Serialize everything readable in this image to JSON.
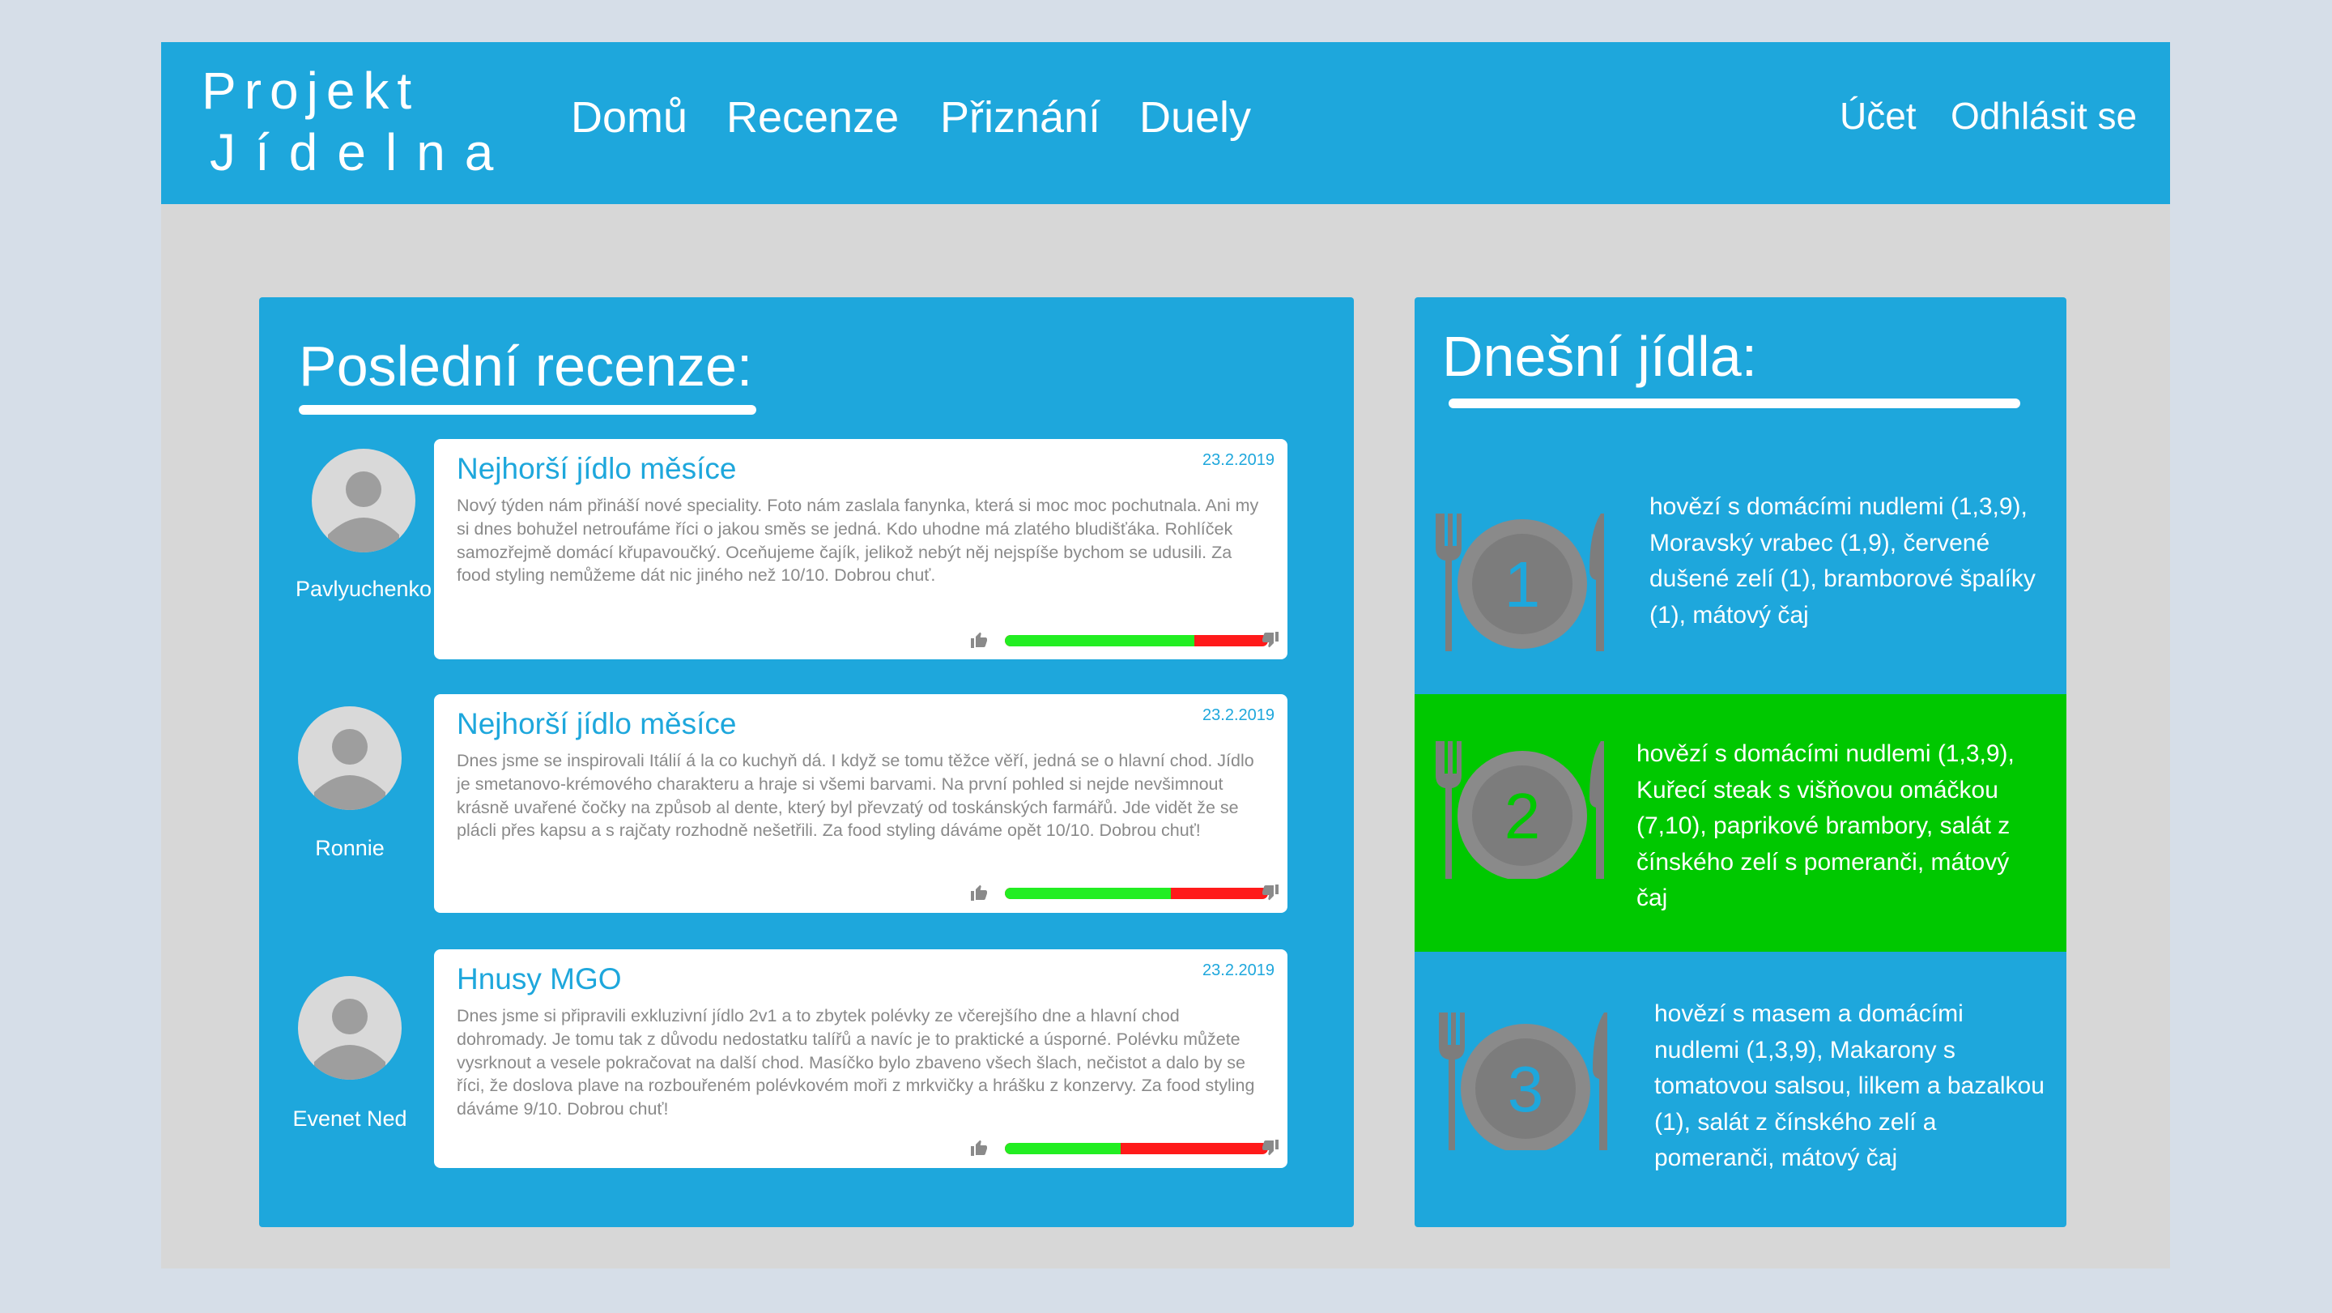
{
  "header": {
    "logo_line1": "Projekt",
    "logo_line2": "Jídelna",
    "nav": [
      "Domů",
      "Recenze",
      "Přiznání",
      "Duely"
    ],
    "account": "Účet",
    "logout": "Odhlásit se"
  },
  "colors": {
    "primary": "#1ea7dc",
    "active_meal": "#00c800",
    "like": "#22ee22",
    "dislike": "#ff1a1a"
  },
  "reviews_panel": {
    "title": "Poslední recenze:",
    "reviews": [
      {
        "author": "Pavlyuchenko",
        "title": "Nejhorší jídlo měsíce",
        "date": "23.2.2019",
        "text": "Nový týden nám přináší nové speciality. Foto nám zaslala fanynka, která si moc moc pochutnala. Ani my si dnes bohužel netroufáme říci o jakou směs se jedná. Kdo uhodne má zlatého bludišťáka. Rohlíček samozřejmě domácí křupavoučký. Oceňujeme čajík, jelikož nebýt něj nejspíše bychom se udusili. Za food styling nemůžeme dát nic jiného než 10/10. Dobrou chuť.",
        "like_ratio": 0.72
      },
      {
        "author": "Ronnie",
        "title": "Nejhorší jídlo měsíce",
        "date": "23.2.2019",
        "text": "Dnes jsme se inspirovali Itálií á la co kuchyň dá. I když se tomu těžce věří, jedná se o hlavní chod. Jídlo je smetanovo-krémového charakteru a hraje si všemi barvami. Na první pohled si nejde nevšimnout krásně uvařené čočky na způsob al dente, který byl převzatý od toskánských farmářů. Jde vidět že se plácli přes kapsu a s rajčaty rozhodně nešetřili. Za food styling dáváme opět 10/10. Dobrou chuť!",
        "like_ratio": 0.63
      },
      {
        "author": "Evenet Ned",
        "title": "Hnusy MGO",
        "date": "23.2.2019",
        "text": "Dnes jsme si připravili exkluzivní jídlo 2v1 a to zbytek polévky ze včerejšího dne a hlavní chod dohromady. Je tomu tak z důvodu nedostatku talířů a navíc je to praktické a úsporné. Polévku můžete vysrknout a vesele pokračovat na další chod. Masíčko bylo zbaveno všech šlach, nečistot a dalo by se říci, že doslova plave na rozbouřeném polévkovém moři z mrkvičky a hrášku z konzervy. Za food styling dáváme 9/10. Dobrou chuť!",
        "like_ratio": 0.44
      }
    ]
  },
  "meals_panel": {
    "title": "Dnešní jídla:",
    "meals": [
      {
        "number": "1",
        "text": "hovězí s domácími nudlemi (1,3,9), Moravský vrabec (1,9), červené dušené zelí (1), bramborové špalíky (1), mátový čaj",
        "active": false
      },
      {
        "number": "2",
        "text": "hovězí s domácími nudlemi (1,3,9), Kuřecí steak s višňovou omáčkou (7,10), paprikové brambory, salát z čínského zelí s pomeranči, mátový čaj",
        "active": true
      },
      {
        "number": "3",
        "text": "hovězí s masem a domácími nudlemi (1,3,9), Makarony s tomatovou salsou, lilkem a bazalkou (1), salát z čínského zelí a pomeranči, mátový čaj",
        "active": false
      }
    ]
  }
}
